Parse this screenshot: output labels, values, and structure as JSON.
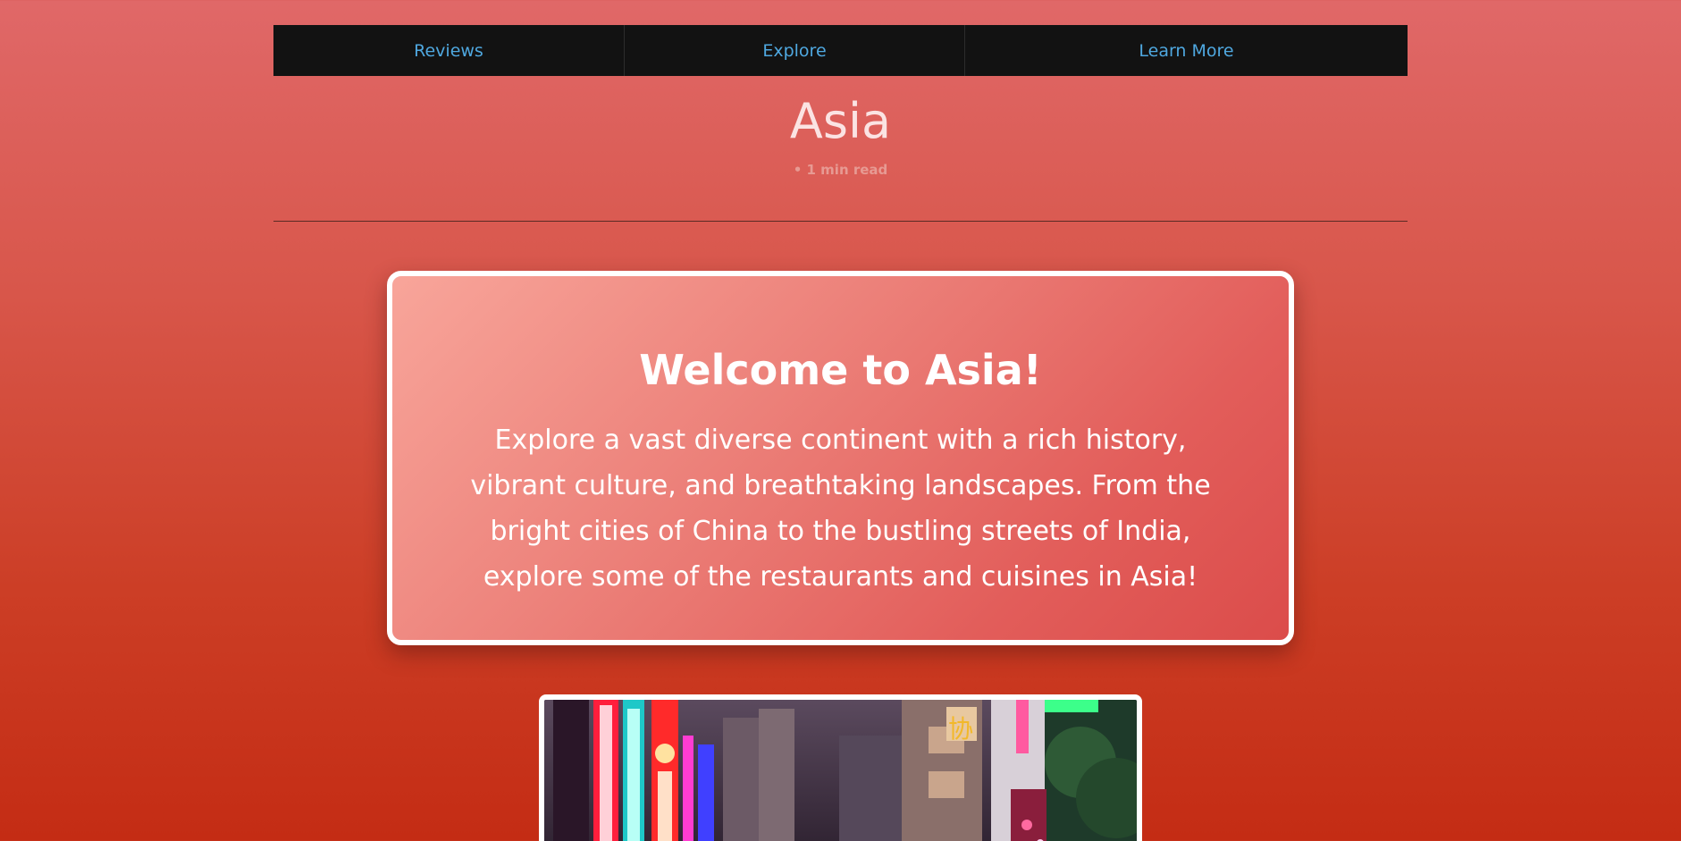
{
  "nav": {
    "items": [
      {
        "label": "Reviews"
      },
      {
        "label": "Explore"
      },
      {
        "label": "Learn More"
      }
    ]
  },
  "header": {
    "title": "Asia",
    "read_time": "• 1 min read"
  },
  "welcome": {
    "title": "Welcome to Asia!",
    "text": "Explore a vast diverse continent with a rich history, vibrant culture, and breathtaking landscapes. From the bright cities of China to the bustling streets of India, explore some of the restaurants and cuisines in Asia!"
  },
  "colors": {
    "nav_background": "#121212",
    "nav_link": "#4fa8e0",
    "page_gradient_top": "#e06868",
    "page_gradient_bottom": "#c42c14",
    "card_border": "#ffffff"
  },
  "photo": {
    "subject": "neon-lit city street at night"
  }
}
